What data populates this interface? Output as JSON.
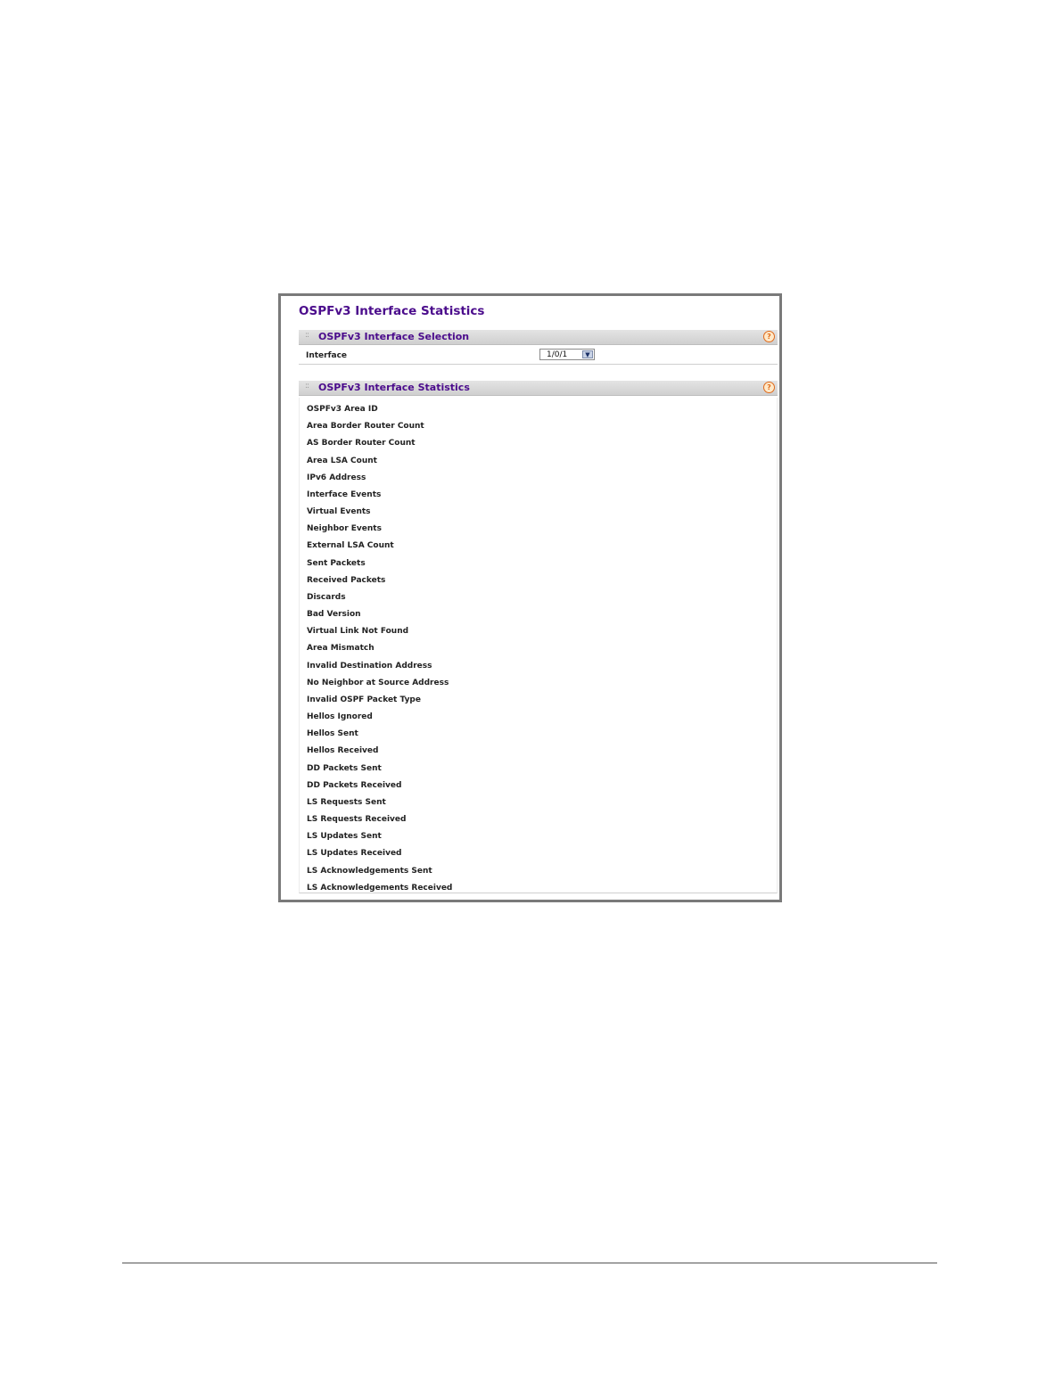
{
  "page": {
    "title": "OSPFv3 Interface Statistics"
  },
  "selection_section": {
    "title": "OSPFv3 Interface Selection",
    "help_icon": "help-icon",
    "interface_label": "Interface",
    "interface_value": "1/0/1"
  },
  "stats_section": {
    "title": "OSPFv3 Interface Statistics",
    "help_icon": "help-icon",
    "rows": [
      "OSPFv3 Area ID",
      "Area Border Router Count",
      "AS Border Router Count",
      "Area LSA Count",
      "IPv6 Address",
      "Interface Events",
      "Virtual Events",
      "Neighbor Events",
      "External LSA Count",
      "Sent Packets",
      "Received Packets",
      "Discards",
      "Bad Version",
      "Virtual Link Not Found",
      "Area Mismatch",
      "Invalid Destination Address",
      "No Neighbor at Source Address",
      "Invalid OSPF Packet Type",
      "Hellos Ignored",
      "Hellos Sent",
      "Hellos Received",
      "DD Packets Sent",
      "DD Packets Received",
      "LS Requests Sent",
      "LS Requests Received",
      "LS Updates Sent",
      "LS Updates Received",
      "LS Acknowledgements Sent",
      "LS Acknowledgements Received"
    ]
  },
  "colors": {
    "title_purple": "#4b0c8c",
    "header_gray": "#d8d8d8",
    "help_orange": "#e06a1a"
  }
}
